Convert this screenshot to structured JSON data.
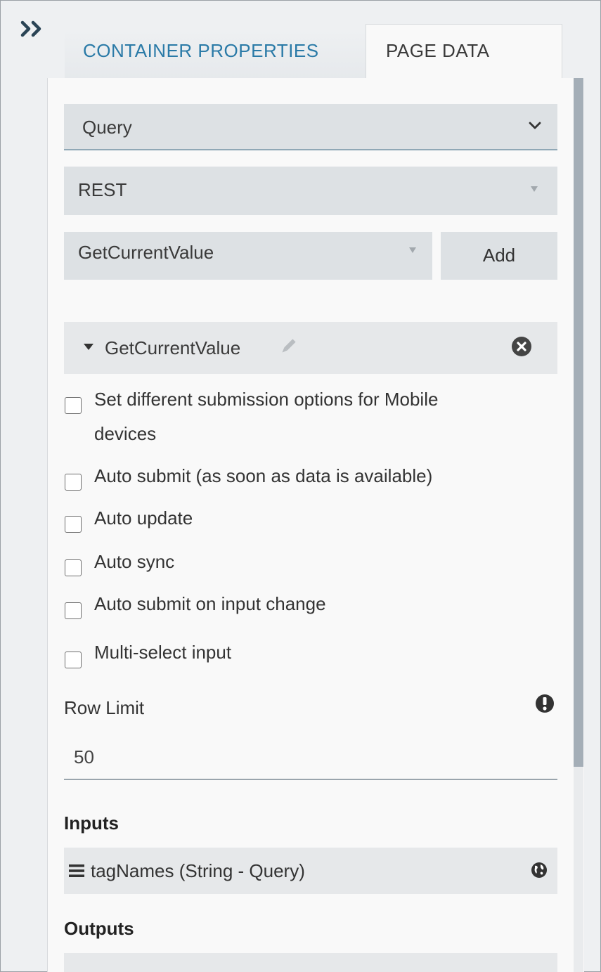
{
  "tabs": {
    "container_properties": "CONTAINER PROPERTIES",
    "page_data": "PAGE DATA"
  },
  "selects": {
    "query_type": "Query",
    "service_type": "REST",
    "query_name": "GetCurrentValue"
  },
  "add_button": "Add",
  "query": {
    "name": "GetCurrentValue",
    "options": [
      "Set different submission options for Mobile",
      "devices",
      "Auto submit (as soon as data is available)",
      "Auto update",
      "Auto sync",
      "Auto submit on input change",
      "Multi-select input"
    ],
    "row_limit_label": "Row Limit",
    "row_limit_value": "50"
  },
  "inputs": {
    "title": "Inputs",
    "items": [
      "tagNames (String - Query)"
    ]
  },
  "outputs": {
    "title": "Outputs"
  },
  "colors": {
    "accent_tab": "#2a7aa7",
    "field_bg": "#dde1e4",
    "scrollbar": "#a4aeb7"
  },
  "icons": [
    "double-chevron-right-icon",
    "chevron-down-icon",
    "caret-down-icon",
    "pencil-icon",
    "close-circle-icon",
    "exclamation-icon",
    "hamburger-icon",
    "globe-icon"
  ]
}
